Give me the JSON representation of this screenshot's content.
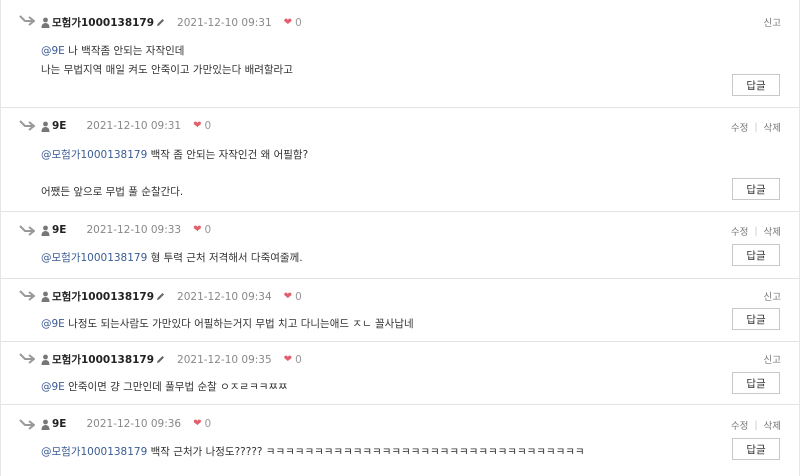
{
  "icons": {
    "reply_arrow": "reply-arrow-icon",
    "user": "user-icon",
    "pencil": "pencil-icon",
    "heart": "heart-icon"
  },
  "colors": {
    "mention": "#3b5b95",
    "heart": "#e2606e",
    "divider": "#e3e3e3"
  },
  "comments": [
    {
      "author": "모험가1000138179",
      "date": "2021-12-10 09:31",
      "likes": "0",
      "actions": [
        "신고"
      ],
      "mention": "@9E",
      "lines": [
        "나 백작좀 안되는 자작인데",
        "나는 무법지역 매일 켜도 안죽이고 가만있는다 배려할라고"
      ],
      "reply_label": "답글"
    },
    {
      "author": "9E",
      "date": "2021-12-10 09:31",
      "likes": "0",
      "actions": [
        "수정",
        "삭제"
      ],
      "mention": "@모험가1000138179",
      "lines": [
        "백작 좀 안되는 자작인건 왜 어필함?",
        "어쨌든 앞으로 무법 풀 순찰간다."
      ],
      "reply_label": "답글"
    },
    {
      "author": "9E",
      "date": "2021-12-10 09:33",
      "likes": "0",
      "actions": [
        "수정",
        "삭제"
      ],
      "mention": "@모험가1000138179",
      "lines": [
        "형 투력 근처 저격해서 다죽여줄께."
      ],
      "reply_label": "답글"
    },
    {
      "author": "모험가1000138179",
      "date": "2021-12-10 09:34",
      "likes": "0",
      "actions": [
        "신고"
      ],
      "mention": "@9E",
      "lines": [
        "나정도 되는사람도 가만있다 어필하는거지 무법 치고 다니는애드 ㅈㄴ 꼴사납네"
      ],
      "reply_label": "답글"
    },
    {
      "author": "모험가1000138179",
      "date": "2021-12-10 09:35",
      "likes": "0",
      "actions": [
        "신고"
      ],
      "mention": "@9E",
      "lines": [
        "안죽이면 걍 그만인데 풀무법 순찰 ㅇㅈㄹㅋㅋㅉㅉ"
      ],
      "reply_label": "답글"
    },
    {
      "author": "9E",
      "date": "2021-12-10 09:36",
      "likes": "0",
      "actions": [
        "수정",
        "삭제"
      ],
      "mention": "@모험가1000138179",
      "lines": [
        "백작 근처가 나정도????? ㅋㅋㅋㅋㅋㅋㅋㅋㅋㅋㅋㅋㅋㅋㅋㅋㅋㅋㅋㅋㅋㅋㅋㅋㅋㅋㅋㅋㅋㅋㅋㅋㅋ"
      ],
      "reply_label": "답글"
    }
  ]
}
